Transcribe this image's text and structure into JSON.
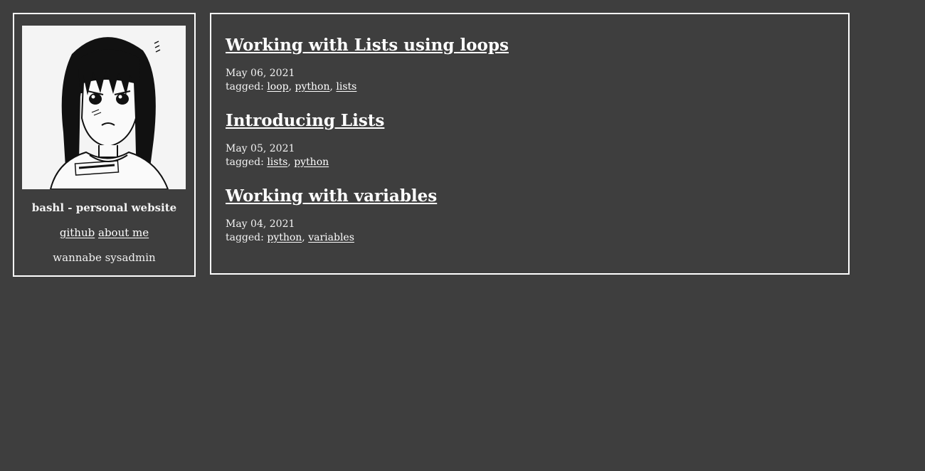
{
  "sidebar": {
    "site_title": "bashl - personal website",
    "links": [
      {
        "label": "github"
      },
      {
        "label": "about me"
      }
    ],
    "tagline": "wannabe sysadmin"
  },
  "posts": [
    {
      "title": "Working with Lists using loops",
      "date": "May 06, 2021",
      "tagged_label": "tagged:",
      "tags": [
        "loop",
        "python",
        "lists"
      ]
    },
    {
      "title": "Introducing Lists",
      "date": "May 05, 2021",
      "tagged_label": "tagged:",
      "tags": [
        "lists",
        "python"
      ]
    },
    {
      "title": "Working with variables",
      "date": "May 04, 2021",
      "tagged_label": "tagged:",
      "tags": [
        "python",
        "variables"
      ]
    }
  ],
  "colors": {
    "background": "#3e3e3e",
    "border": "#ffffff",
    "text": "#f2f2f2"
  }
}
